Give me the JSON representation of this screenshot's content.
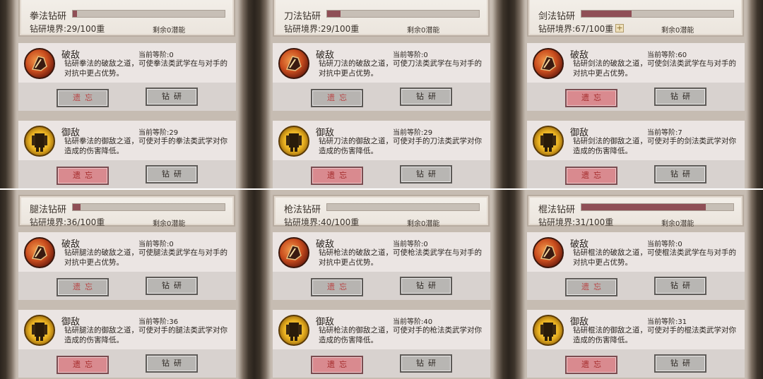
{
  "panels": [
    {
      "title": "拳法钻研",
      "realm": "钻研境界:29/100重",
      "remaining": "剩余0潜能",
      "progress": 0.03,
      "plus": "",
      "cards": [
        {
          "name": "破敌",
          "level": "当前等阶:0",
          "desc": "钻研拳法的破敌之道，可使拳法类武学在与对手的对抗中更占优势。",
          "forget": "遗忘",
          "study": "钻研",
          "forget_active": false
        },
        {
          "name": "御敌",
          "level": "当前等阶:29",
          "desc": "钻研拳法的御敌之道，可使对手的拳法类武学对你造成的伤害降低。",
          "forget": "遗忘",
          "study": "钻研",
          "forget_active": true
        }
      ]
    },
    {
      "title": "刀法钻研",
      "realm": "钻研境界:29/100重",
      "remaining": "剩余0潜能",
      "progress": 0.09,
      "plus": "",
      "cards": [
        {
          "name": "破敌",
          "level": "当前等阶:0",
          "desc": "钻研刀法的破敌之道，可使刀法类武学在与对手的对抗中更占优势。",
          "forget": "遗忘",
          "study": "钻研",
          "forget_active": false
        },
        {
          "name": "御敌",
          "level": "当前等阶:29",
          "desc": "钻研刀法的御敌之道，可使对手的刀法类武学对你造成的伤害降低。",
          "forget": "遗忘",
          "study": "钻研",
          "forget_active": true
        }
      ]
    },
    {
      "title": "剑法钻研",
      "realm": "钻研境界:67/100重",
      "remaining": "剩余0潜能",
      "progress": 0.33,
      "plus": "+",
      "cards": [
        {
          "name": "破敌",
          "level": "当前等阶:60",
          "desc": "钻研剑法的破敌之道，可使剑法类武学在与对手的对抗中更占优势。",
          "forget": "遗忘",
          "study": "钻研",
          "forget_active": true
        },
        {
          "name": "御敌",
          "level": "当前等阶:7",
          "desc": "钻研剑法的御敌之道，可使对手的剑法类武学对你造成的伤害降低。",
          "forget": "遗忘",
          "study": "钻研",
          "forget_active": true
        }
      ]
    },
    {
      "title": "腿法钻研",
      "realm": "钻研境界:36/100重",
      "remaining": "剩余0潜能",
      "progress": 0.05,
      "plus": "",
      "cards": [
        {
          "name": "破敌",
          "level": "当前等阶:0",
          "desc": "钻研腿法的破敌之道，可使腿法类武学在与对手的对抗中更占优势。",
          "forget": "遗忘",
          "study": "钻研",
          "forget_active": false
        },
        {
          "name": "御敌",
          "level": "当前等阶:36",
          "desc": "钻研腿法的御敌之道，可使对手的腿法类武学对你造成的伤害降低。",
          "forget": "遗忘",
          "study": "钻研",
          "forget_active": true
        }
      ]
    },
    {
      "title": "枪法钻研",
      "realm": "钻研境界:40/100重",
      "remaining": "剩余0潜能",
      "progress": 0.0,
      "plus": "",
      "cards": [
        {
          "name": "破敌",
          "level": "当前等阶:0",
          "desc": "钻研枪法的破敌之道，可使枪法类武学在与对手的对抗中更占优势。",
          "forget": "遗忘",
          "study": "钻研",
          "forget_active": false
        },
        {
          "name": "御敌",
          "level": "当前等阶:40",
          "desc": "钻研枪法的御敌之道，可使对手的枪法类武学对你造成的伤害降低。",
          "forget": "遗忘",
          "study": "钻研",
          "forget_active": true
        }
      ]
    },
    {
      "title": "棍法钻研",
      "realm": "钻研境界:31/100重",
      "remaining": "剩余0潜能",
      "progress": 0.82,
      "plus": "",
      "cards": [
        {
          "name": "破敌",
          "level": "当前等阶:0",
          "desc": "钻研棍法的破敌之道，可使棍法类武学在与对手的对抗中更占优势。",
          "forget": "遗忘",
          "study": "钻研",
          "forget_active": false
        },
        {
          "name": "御敌",
          "level": "当前等阶:31",
          "desc": "钻研棍法的御敌之道，可使对手的棍法类武学对你造成的伤害降低。",
          "forget": "遗忘",
          "study": "钻研",
          "forget_active": true
        }
      ]
    }
  ],
  "colors": {
    "progress_fill": "#8f4f56",
    "forget_active_bg": "#d98a8f",
    "forget_text": "#b94444"
  },
  "icons": [
    "break-enemy-fist-icon",
    "defend-enemy-armor-icon"
  ]
}
